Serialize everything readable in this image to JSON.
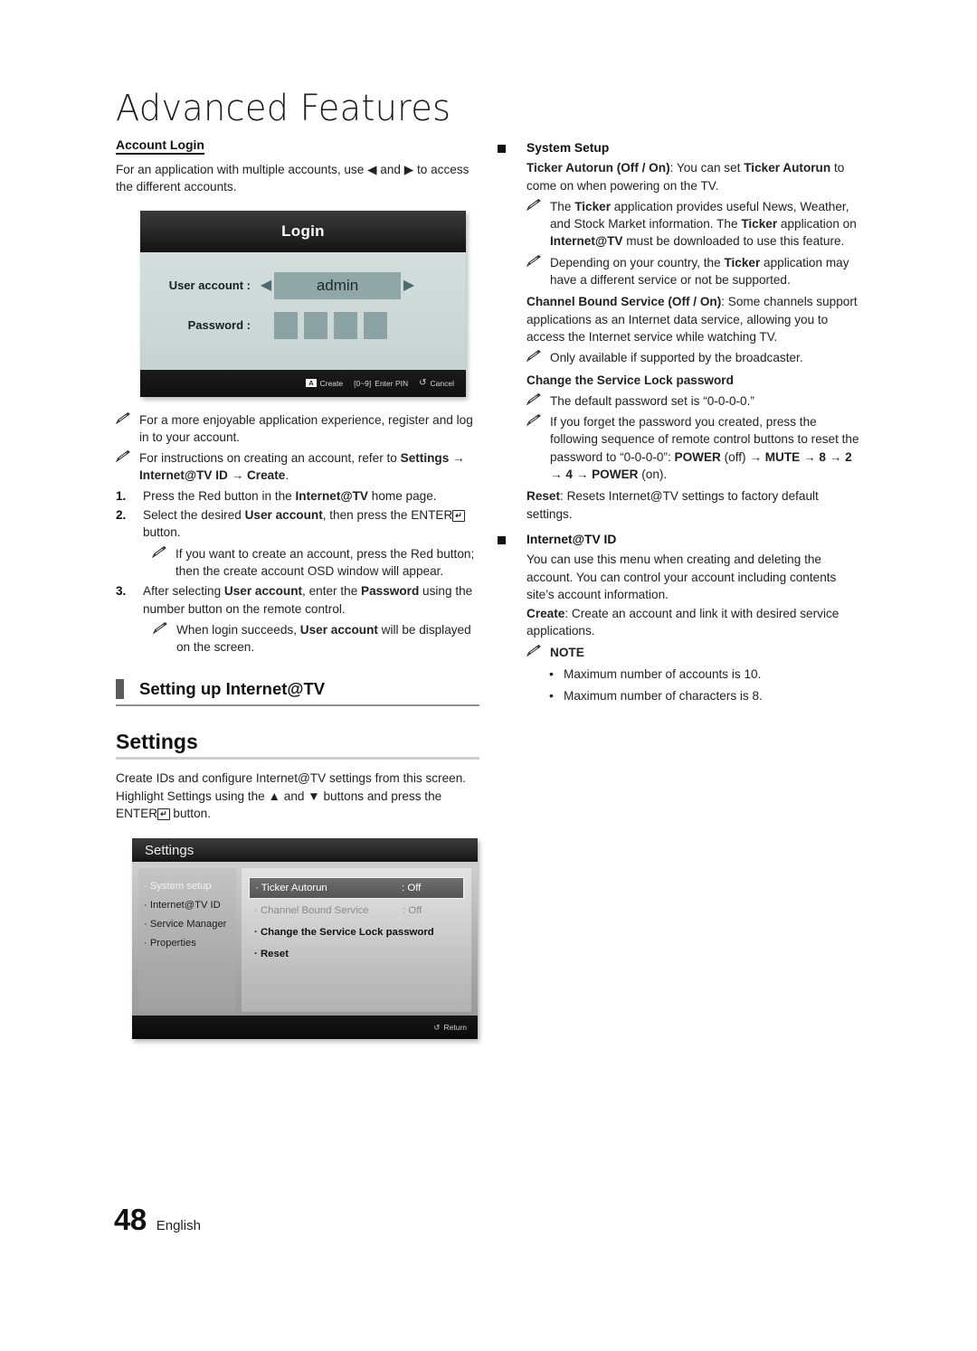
{
  "page": {
    "chapter_title": "Advanced Features",
    "page_number": "48",
    "language": "English"
  },
  "left_column": {
    "account_login": {
      "heading": "Account Login",
      "intro_before": "For an application with multiple accounts, use ",
      "arrow_left": "◀",
      "intro_mid": " and ",
      "arrow_right": "▶",
      "intro_after": " to access the different accounts."
    },
    "login_osd": {
      "title": "Login",
      "user_account_label": "User account :",
      "user_account_value": "admin",
      "password_label": "Password :",
      "password_boxes": 4,
      "arrow_left": "◀",
      "arrow_right": "▶",
      "footer": {
        "create_key": "A",
        "create_label": "Create",
        "pin_key": "[0~9]",
        "pin_label": "Enter PIN",
        "cancel_glyph": "↺",
        "cancel_label": "Cancel"
      }
    },
    "notes": [
      "For a more enjoyable application experience, register and log in to your account."
    ],
    "note_create_account": {
      "line1": "For instructions on creating an account, refer to ",
      "bold_path": "Settings → Internet@TV ID → Create",
      "trailing": "."
    },
    "steps": [
      {
        "num": "1.",
        "parts": [
          "Press the Red button in the ",
          "Internet@TV",
          " home page."
        ]
      },
      {
        "num": "2.",
        "parts": [
          "Select the desired ",
          "User account",
          ", then press the ENTER"
        ],
        "suffix": " button."
      },
      {
        "num": "3.",
        "parts": [
          "After selecting ",
          "User account",
          ", enter the ",
          "Password",
          " using the number button on the remote control."
        ]
      }
    ],
    "step2_note": "If you want to create an account, press the Red button; then the create account OSD window will appear.",
    "step3_note_parts": [
      "When login succeeds, ",
      "User account",
      " will be displayed on the screen."
    ],
    "section_bar_title": "Setting up Internet@TV",
    "settings_h2": "Settings",
    "settings_intro_parts": [
      "Create IDs and configure Internet@TV settings from this screen. Highlight Settings using the ",
      "▲",
      " and ",
      "▼",
      " buttons and press the ENTER"
    ],
    "settings_intro_suffix": " button.",
    "settings_osd": {
      "title": "Settings",
      "menu": [
        {
          "label": "· System setup",
          "state": "selected"
        },
        {
          "label": "· Internet@TV ID",
          "state": "normal"
        },
        {
          "label": "· Service Manager",
          "state": "normal"
        },
        {
          "label": "· Properties",
          "state": "normal"
        }
      ],
      "options": [
        {
          "name": "· Ticker Autorun",
          "value": ": Off",
          "state": "selected"
        },
        {
          "name": "· Channel Bound Service",
          "value": ": Off",
          "state": "disabled"
        },
        {
          "name": "· Change the Service Lock password",
          "value": "",
          "state": "bold"
        },
        {
          "name": "· Reset",
          "value": "",
          "state": "bold"
        }
      ],
      "footer_glyph": "↺",
      "footer_label": "Return"
    }
  },
  "right_column": {
    "system_setup": {
      "heading": "System Setup",
      "ticker_autorun_bold": "Ticker Autorun (Off / On)",
      "ticker_autorun_rest_1": ": You can set ",
      "ticker_autorun_bold2": "Ticker Autorun",
      "ticker_autorun_rest_2": " to come on when powering on the TV.",
      "note_ticker_parts": [
        "The ",
        "Ticker",
        " application provides useful News, Weather, and Stock Market information. The ",
        "Ticker",
        " application on ",
        "Internet@TV",
        " must be downloaded to use this feature."
      ],
      "note_country_parts": [
        "Depending on your country, the ",
        "Ticker",
        " application may have a different service or not be supported."
      ],
      "channel_bound_bold": "Channel Bound Service (Off / On)",
      "channel_bound_rest": ": Some channels support applications as an Internet data service, allowing you to access the Internet service while watching TV.",
      "note_broadcaster": "Only available if supported by the broadcaster.",
      "change_pw_heading": "Change the Service Lock password",
      "note_default_pw": "The default password set is “0-0-0-0.”",
      "note_forgot_pw_parts": [
        "If you forget the password you created, press the following sequence of remote control buttons to reset the password to “0-0-0-0”: ",
        "POWER",
        " (off) → ",
        "MUTE",
        " → ",
        "8",
        " → ",
        "2",
        " → ",
        "4",
        " → ",
        "POWER",
        " (on)."
      ],
      "reset_bold": "Reset",
      "reset_rest": ": Resets Internet@TV settings to factory default settings."
    },
    "internet_tv_id": {
      "heading": "Internet@TV ID",
      "body": "You can use this menu when creating and deleting the account. You can control your account including contents site’s account information.",
      "create_bold": "Create",
      "create_rest": ": Create an account and link it with desired service applications.",
      "note_label": "NOTE",
      "note_items": [
        "Maximum number of accounts is 10.",
        "Maximum number of characters is 8."
      ],
      "bullet": "•"
    }
  },
  "colors": {
    "osd_login_body": "#d0dbda",
    "osd_login_box": "#8ba3a5",
    "osd_login_value_box": "#90a7a8",
    "section_bar": "#5a5a5a",
    "text": "#222222"
  }
}
